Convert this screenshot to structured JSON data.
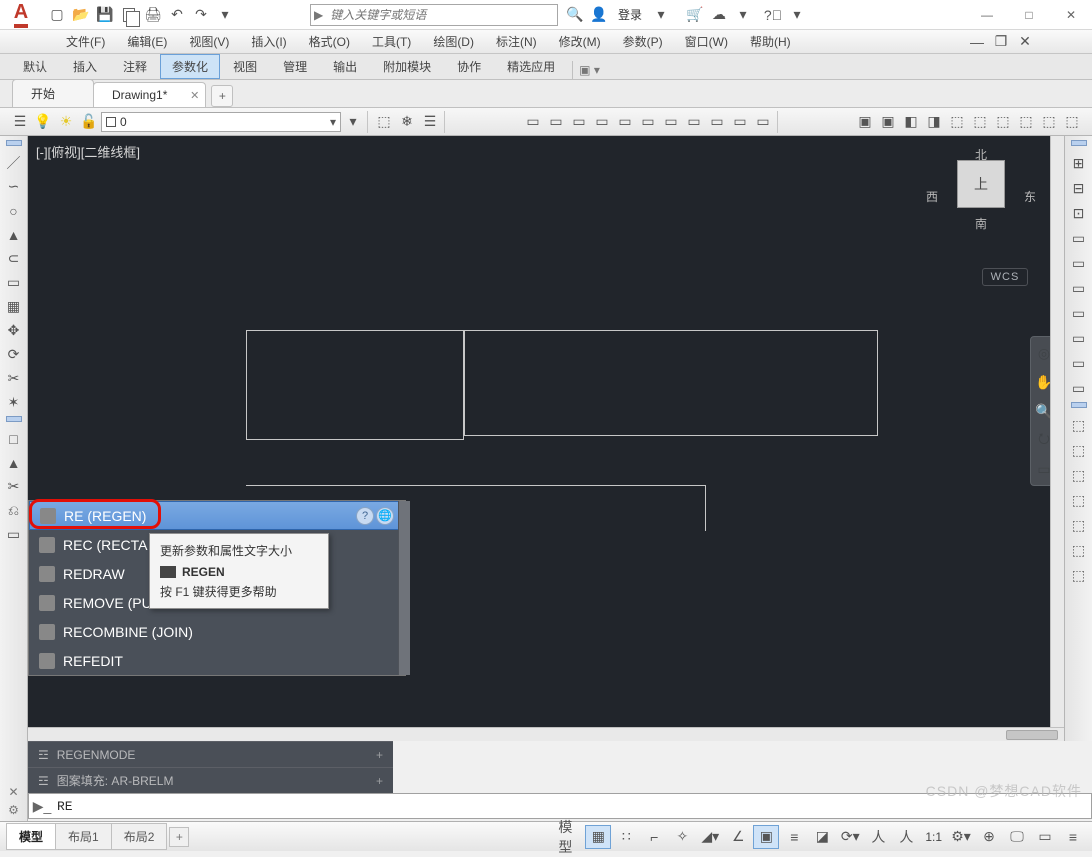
{
  "titlebar": {
    "search_placeholder": "键入关键字或短语",
    "login_label": "登录"
  },
  "menubar": {
    "items": [
      "文件(F)",
      "编辑(E)",
      "视图(V)",
      "插入(I)",
      "格式(O)",
      "工具(T)",
      "绘图(D)",
      "标注(N)",
      "修改(M)",
      "参数(P)",
      "窗口(W)",
      "帮助(H)"
    ]
  },
  "ribbon_tabs": {
    "items": [
      "默认",
      "插入",
      "注释",
      "参数化",
      "视图",
      "管理",
      "输出",
      "附加模块",
      "协作",
      "精选应用"
    ],
    "active": "参数化"
  },
  "file_tabs": {
    "items": [
      {
        "label": "开始",
        "closeable": false
      },
      {
        "label": "Drawing1*",
        "closeable": true
      }
    ],
    "active": "Drawing1*"
  },
  "layer_dd": {
    "current": "0"
  },
  "viewport_label": "[-][俯视][二维线框]",
  "viewcube": {
    "face": "上",
    "n": "北",
    "s": "南",
    "w": "西",
    "e": "东",
    "wcs": "WCS"
  },
  "autocomplete": {
    "items": [
      {
        "label": "RE (REGEN)",
        "selected": true
      },
      {
        "label": "REC (RECTA"
      },
      {
        "label": "REDRAW"
      },
      {
        "label": "REMOVE (PU"
      },
      {
        "label": "RECOMBINE (JOIN)"
      },
      {
        "label": "REFEDIT"
      }
    ],
    "tooltip": {
      "line1": "更新参数和属性文字大小",
      "title": "REGEN",
      "line2": "按 F1 键获得更多帮助"
    }
  },
  "history": [
    {
      "label": "REGENMODE"
    },
    {
      "label": "图案填充: AR-BRELM"
    }
  ],
  "command_input": "RE",
  "layout_tabs": {
    "items": [
      "模型",
      "布局1",
      "布局2"
    ],
    "active": "模型"
  },
  "status_scale": "1:1",
  "watermark": "CSDN @梦想CAD软件"
}
